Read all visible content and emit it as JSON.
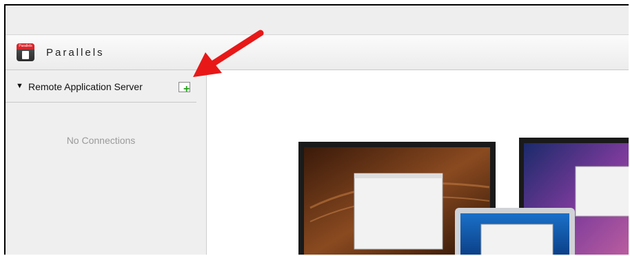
{
  "app": {
    "name": "Parallels",
    "logo_text": "Parallels"
  },
  "sidebar": {
    "section_title": "Remote Application Server",
    "empty_text": "No Connections"
  },
  "annotation": {
    "color": "#e81818"
  }
}
